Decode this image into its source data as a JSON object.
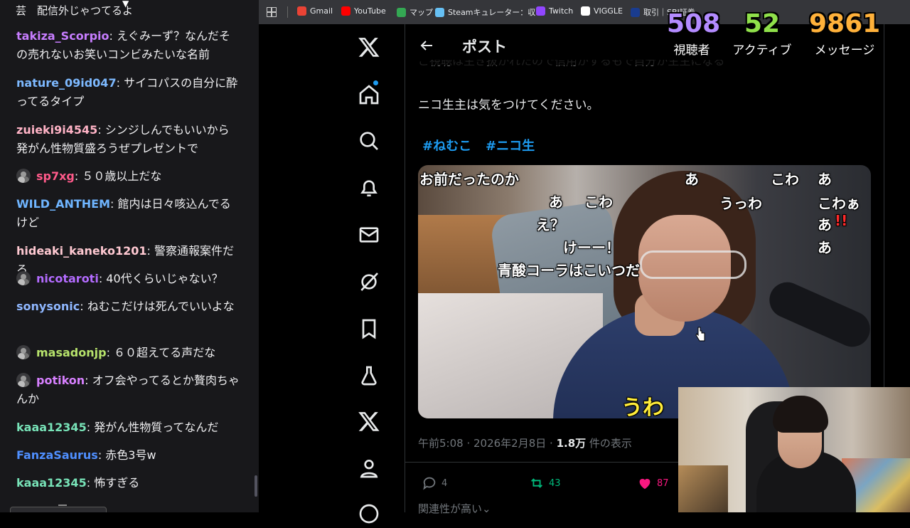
{
  "chat": {
    "top_fragment": "芸　配信外じゃつてるよ",
    "messages": [
      {
        "user": "takiza_Scorpio",
        "color": "#c77dff",
        "badge": false,
        "text": "えぐみーず？なんだその売れないお笑いコンビみたいな名前"
      },
      {
        "user": "nature_09id047",
        "color": "#7db9ff",
        "badge": false,
        "text": "サイコパスの自分に酔ってるタイプ"
      },
      {
        "user": "zuieki9i4545",
        "color": "#ffb3c6",
        "badge": false,
        "text": "シンジしんでもいいから発がん性物質盛ろうぜプレゼントで"
      },
      {
        "user": "sp7xg",
        "color": "#ff5a8a",
        "badge": true,
        "text": "５０歳以上だな"
      },
      {
        "user": "WILD_ANTHEM",
        "color": "#6fb5ff",
        "badge": false,
        "text": "館内は日々咳込んでるけど"
      },
      {
        "user": "hideaki_kaneko1201",
        "color": "#ffc9d2",
        "badge": false,
        "text": "警察通報案件だろ"
      },
      {
        "user": "nicotaroti",
        "color": "#b36bff",
        "badge": true,
        "text": "40代くらいじゃない？"
      },
      {
        "user": "sonysonic",
        "color": "#8fb7ff",
        "badge": false,
        "text": "ねむこだけは死んでいいよな"
      },
      {
        "user": "masadonjp",
        "color": "#b7e36c",
        "badge": true,
        "text": "６０超えてる声だな"
      },
      {
        "user": "potikon",
        "color": "#d780ff",
        "badge": true,
        "text": "オフ会やってるとか贅肉ちゃんか"
      },
      {
        "user": "kaaa12345",
        "color": "#78e3b8",
        "badge": false,
        "text": "発がん性物質ってなんだ"
      },
      {
        "user": "FanzaSaurus",
        "color": "#4f8fff",
        "badge": false,
        "text": "赤色3号w"
      },
      {
        "user": "kaaa12345",
        "color": "#78e3b8",
        "badge": false,
        "text": "怖すぎる"
      }
    ]
  },
  "bookmarks": [
    {
      "label": "Gmail",
      "color": "#ea4335"
    },
    {
      "label": "YouTube",
      "color": "#ff0000"
    },
    {
      "label": "マップ",
      "color": "#34a853"
    },
    {
      "label": "Steamキュレーター：収...",
      "color": "#66c0f4"
    },
    {
      "label": "Twitch",
      "color": "#9146ff"
    },
    {
      "label": "VIGGLE",
      "color": "#ffffff"
    },
    {
      "label": "取引｜SBI証券",
      "color": "#1a3c8f"
    }
  ],
  "post": {
    "header_title": "ポスト",
    "partial_line": "ご視聴は生き抜かれたので信用がするもで自分が生主になる",
    "body": "ニコ生主は気をつけてください。",
    "hashtags": [
      "#ねむこ",
      "#ニコ生"
    ],
    "time": "午前5:08 · 2026年2月8日 · ",
    "views": "1.8万",
    "views_suffix": " 件の表示",
    "replies": "4",
    "reposts": "43",
    "likes": "87",
    "related": "関連性が高い"
  },
  "media_overlay": {
    "t1": "お前だったのか",
    "t2": "あ",
    "t3": "こわ",
    "t4": "あ",
    "t5": "あ",
    "t6": "こわ",
    "t7": "うっわ",
    "t8": "こわぁ",
    "t9": "え？",
    "t10": "あ",
    "t11": "!!",
    "t12": "けーー！",
    "t13": "あ",
    "t14": "青酸コーラはこいつだ",
    "t15": "うわ"
  },
  "stats": {
    "viewers": {
      "value": "508",
      "label": "視聴者",
      "color": "#b38bff"
    },
    "active": {
      "value": "52",
      "label": "アクティブ",
      "color": "#8fe04a"
    },
    "messages": {
      "value": "9861",
      "label": "メッセージ",
      "color": "#ffb13a"
    }
  },
  "icons": [
    "x-logo-icon",
    "home-icon",
    "search-icon",
    "bell-icon",
    "mail-icon",
    "grok-icon",
    "bookmark-icon",
    "flask-icon",
    "x-premium-icon",
    "profile-icon",
    "more-icon"
  ]
}
